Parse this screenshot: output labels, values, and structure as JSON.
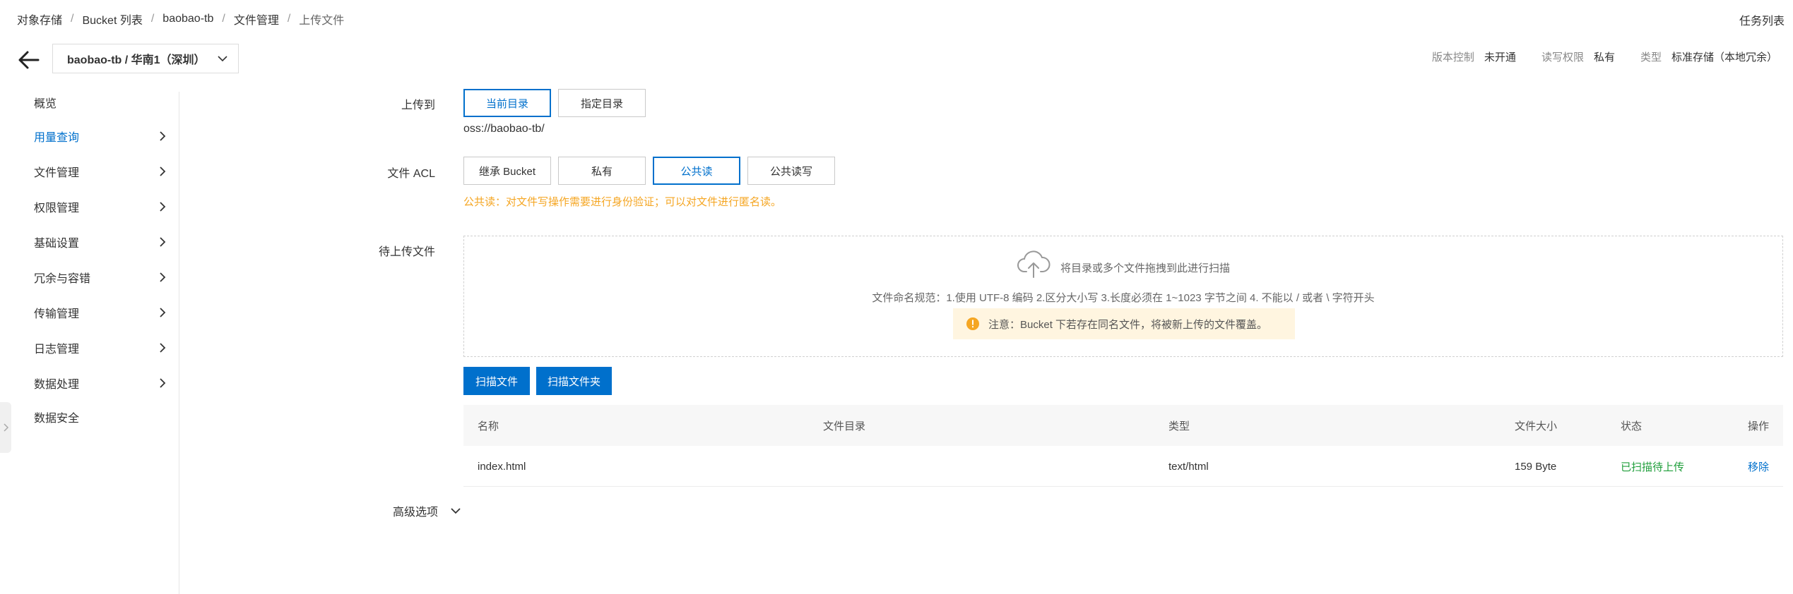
{
  "breadcrumb": [
    "对象存储",
    "Bucket 列表",
    "baobao-tb",
    "文件管理",
    "上传文件"
  ],
  "header": {
    "task_list": "任务列表",
    "bucket_select": "baobao-tb / 华南1（深圳）",
    "meta": {
      "version_label": "版本控制",
      "version_value": "未开通",
      "rw_label": "读写权限",
      "rw_value": "私有",
      "type_label": "类型",
      "type_value": "标准存储（本地冗余）"
    }
  },
  "sidebar": {
    "items": [
      {
        "label": "概览",
        "has_children": false,
        "active": false
      },
      {
        "label": "用量查询",
        "has_children": true,
        "active": true
      },
      {
        "label": "文件管理",
        "has_children": true,
        "active": false
      },
      {
        "label": "权限管理",
        "has_children": true,
        "active": false
      },
      {
        "label": "基础设置",
        "has_children": true,
        "active": false
      },
      {
        "label": "冗余与容错",
        "has_children": true,
        "active": false
      },
      {
        "label": "传输管理",
        "has_children": true,
        "active": false
      },
      {
        "label": "日志管理",
        "has_children": true,
        "active": false
      },
      {
        "label": "数据处理",
        "has_children": true,
        "active": false
      },
      {
        "label": "数据安全",
        "has_children": false,
        "active": false
      }
    ]
  },
  "upload_to": {
    "label": "上传到",
    "options": [
      "当前目录",
      "指定目录"
    ],
    "selected": "当前目录",
    "path": "oss://baobao-tb/"
  },
  "acl": {
    "label": "文件 ACL",
    "options": [
      "继承 Bucket",
      "私有",
      "公共读",
      "公共读写"
    ],
    "selected": "公共读",
    "hint": "公共读：对文件写操作需要进行身份验证；可以对文件进行匿名读。"
  },
  "pending": {
    "label": "待上传文件",
    "drop_text": "将目录或多个文件拖拽到此进行扫描",
    "rules": "文件命名规范：1.使用 UTF-8 编码 2.区分大小写 3.长度必须在 1~1023 字节之间 4. 不能以 / 或者 \\ 字符开头",
    "warning": "注意：Bucket 下若存在同名文件，将被新上传的文件覆盖。"
  },
  "buttons": {
    "scan_file": "扫描文件",
    "scan_folder": "扫描文件夹"
  },
  "table": {
    "headers": {
      "name": "名称",
      "dir": "文件目录",
      "type": "类型",
      "size": "文件大小",
      "status": "状态",
      "op": "操作"
    },
    "rows": [
      {
        "name": "index.html",
        "dir": "",
        "type": "text/html",
        "size": "159 Byte",
        "status": "已扫描待上传",
        "op": "移除"
      }
    ]
  },
  "advanced": {
    "label": "高级选项"
  },
  "colors": {
    "primary": "#0070cc",
    "warning": "#f5a623",
    "success": "#1e9e3a"
  }
}
